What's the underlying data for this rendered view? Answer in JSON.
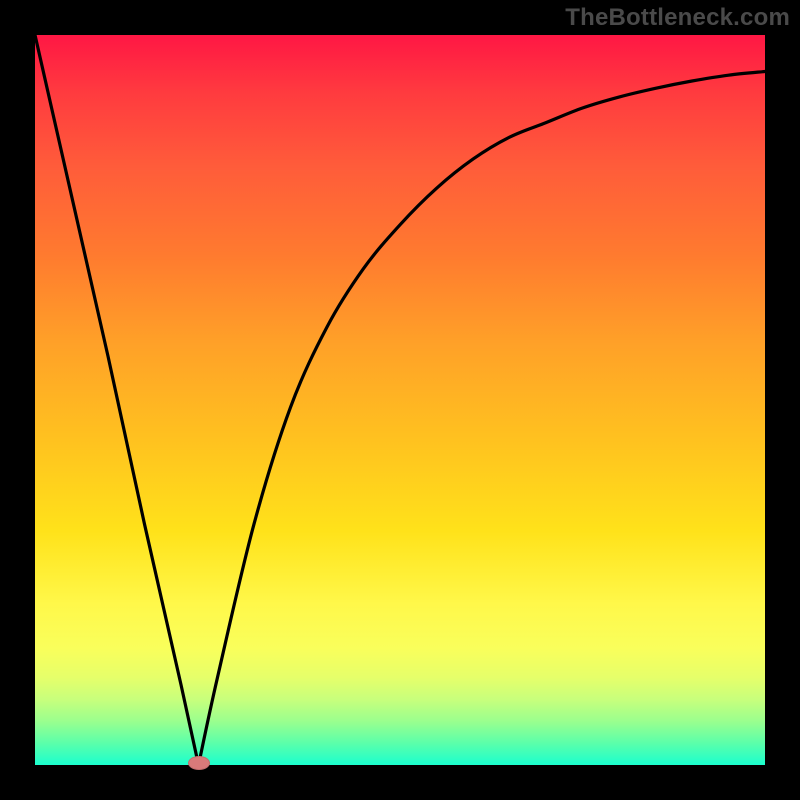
{
  "watermark": "TheBottleneck.com",
  "colors": {
    "frame": "#000000",
    "curve": "#000000",
    "marker": "#d97a7a"
  },
  "chart_data": {
    "type": "line",
    "x": [
      0.0,
      0.05,
      0.1,
      0.15,
      0.2,
      0.224,
      0.25,
      0.3,
      0.35,
      0.4,
      0.45,
      0.5,
      0.55,
      0.6,
      0.65,
      0.7,
      0.75,
      0.8,
      0.85,
      0.9,
      0.95,
      1.0
    ],
    "values": [
      100,
      78,
      56,
      33,
      11,
      0,
      12,
      33,
      49,
      60,
      68,
      74,
      79,
      83,
      86,
      88,
      90,
      91.5,
      92.7,
      93.7,
      94.5,
      95
    ],
    "title": "",
    "xlabel": "",
    "ylabel": "",
    "xlim": [
      0,
      1
    ],
    "ylim": [
      0,
      100
    ],
    "marker": {
      "x": 0.224,
      "y": 0
    },
    "notes": "Y value decreases toward green (minimum bottleneck) at x≈0.224, then rises asymptotically."
  }
}
